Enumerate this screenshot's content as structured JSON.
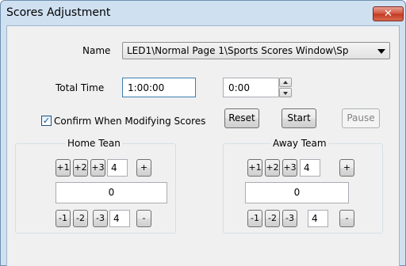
{
  "window": {
    "title": "Scores Adjustment",
    "close_glyph": "✕"
  },
  "name": {
    "label": "Name",
    "value": "LED1\\Normal Page 1\\Sports Scores Window\\Sp"
  },
  "total_time": {
    "label": "Total Time",
    "value": "1:00:00",
    "elapsed": "0:00"
  },
  "confirm": {
    "label": "Confirm When Modifying Scores",
    "checked": true,
    "check_glyph": "✓"
  },
  "buttons": {
    "reset": "Reset",
    "start": "Start",
    "pause": "Pause"
  },
  "home": {
    "title": "Home Tean",
    "inc": [
      "+1",
      "+2",
      "+3"
    ],
    "inc_step": "4",
    "plus": "+",
    "score": "0",
    "dec": [
      "-1",
      "-2",
      "-3"
    ],
    "dec_step": "4",
    "minus": "-"
  },
  "away": {
    "title": "Away Team",
    "inc": [
      "+1",
      "+2",
      "+3"
    ],
    "inc_step": "4",
    "plus": "+",
    "score": "0",
    "dec": [
      "-1",
      "-2",
      "-3"
    ],
    "dec_step": "4",
    "minus": "-"
  },
  "icons": {
    "close": "close-icon",
    "dropdown": "chevron-down-icon",
    "spin_up": "arrow-up-icon",
    "spin_down": "arrow-down-icon",
    "check": "check-icon"
  }
}
